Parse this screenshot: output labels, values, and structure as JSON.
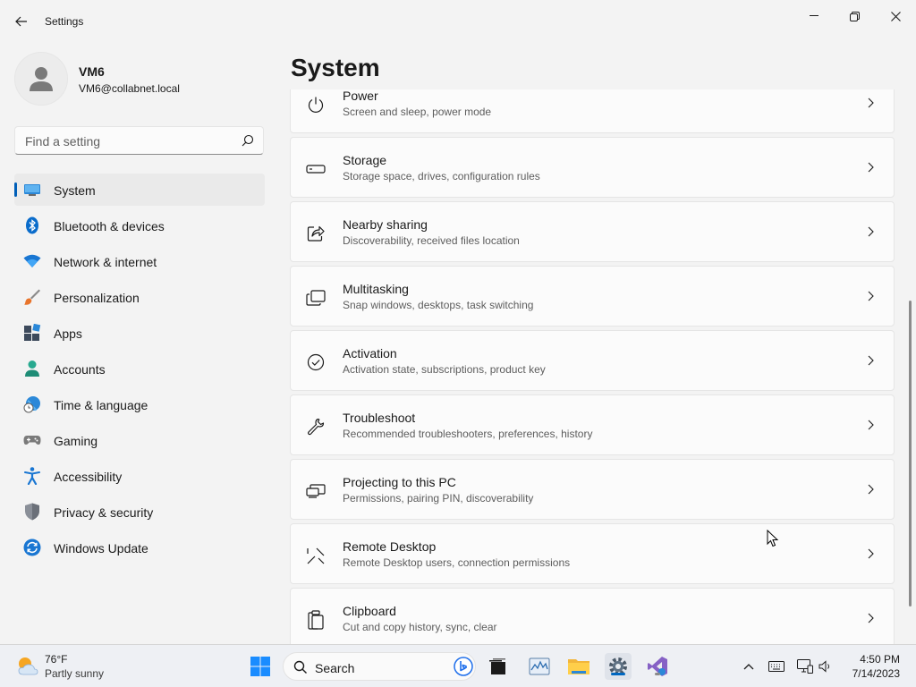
{
  "window": {
    "title": "Settings"
  },
  "profile": {
    "name": "VM6",
    "email": "VM6@collabnet.local"
  },
  "search": {
    "placeholder": "Find a setting"
  },
  "sidebar": {
    "items": [
      {
        "label": "System",
        "icon": "system-icon",
        "active": true
      },
      {
        "label": "Bluetooth & devices",
        "icon": "bluetooth-icon"
      },
      {
        "label": "Network & internet",
        "icon": "wifi-icon"
      },
      {
        "label": "Personalization",
        "icon": "brush-icon"
      },
      {
        "label": "Apps",
        "icon": "apps-icon"
      },
      {
        "label": "Accounts",
        "icon": "account-icon"
      },
      {
        "label": "Time & language",
        "icon": "globe-clock-icon"
      },
      {
        "label": "Gaming",
        "icon": "gamepad-icon"
      },
      {
        "label": "Accessibility",
        "icon": "accessibility-icon"
      },
      {
        "label": "Privacy & security",
        "icon": "shield-icon"
      },
      {
        "label": "Windows Update",
        "icon": "update-icon"
      }
    ]
  },
  "main": {
    "title": "System",
    "cards": [
      {
        "title": "Power",
        "subtitle": "Screen and sleep, power mode",
        "icon": "power-icon"
      },
      {
        "title": "Storage",
        "subtitle": "Storage space, drives, configuration rules",
        "icon": "storage-icon"
      },
      {
        "title": "Nearby sharing",
        "subtitle": "Discoverability, received files location",
        "icon": "share-icon"
      },
      {
        "title": "Multitasking",
        "subtitle": "Snap windows, desktops, task switching",
        "icon": "multitasking-icon"
      },
      {
        "title": "Activation",
        "subtitle": "Activation state, subscriptions, product key",
        "icon": "check-circle-icon"
      },
      {
        "title": "Troubleshoot",
        "subtitle": "Recommended troubleshooters, preferences, history",
        "icon": "wrench-icon"
      },
      {
        "title": "Projecting to this PC",
        "subtitle": "Permissions, pairing PIN, discoverability",
        "icon": "projecting-icon"
      },
      {
        "title": "Remote Desktop",
        "subtitle": "Remote Desktop users, connection permissions",
        "icon": "remote-desktop-icon"
      },
      {
        "title": "Clipboard",
        "subtitle": "Cut and copy history, sync, clear",
        "icon": "clipboard-icon"
      }
    ]
  },
  "taskbar": {
    "weather_temp": "76°F",
    "weather_desc": "Partly sunny",
    "search_label": "Search",
    "time": "4:50 PM",
    "date": "7/14/2023"
  },
  "colors": {
    "accent": "#005fb8",
    "background": "#f3f3f3",
    "card": "#fbfbfb"
  }
}
